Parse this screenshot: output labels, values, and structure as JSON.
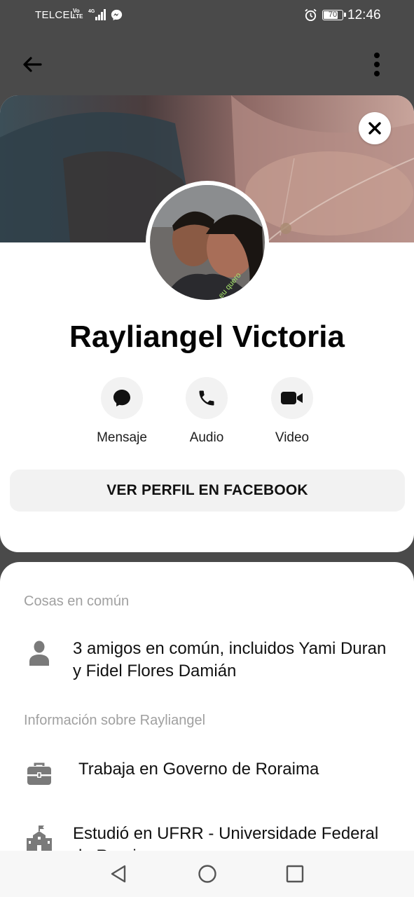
{
  "status_bar": {
    "carrier": "TELCEL",
    "network_top": "Vo",
    "network_bottom": "LTE",
    "network_gen": "4G",
    "battery": "70",
    "time": "12:46"
  },
  "app_bar": {
    "back_icon": "arrow-left-icon",
    "more_icon": "more-vertical-icon"
  },
  "profile": {
    "name": "Rayliangel Victoria",
    "avatar_overlay_text": "eu quero",
    "actions": [
      {
        "label": "Mensaje",
        "icon": "chat-bubble-icon"
      },
      {
        "label": "Audio",
        "icon": "phone-icon"
      },
      {
        "label": "Video",
        "icon": "video-camera-icon"
      }
    ],
    "fb_button": "VER PERFIL EN FACEBOOK"
  },
  "info": {
    "common_header": "Cosas en común",
    "common_friends": "3 amigos en común, incluidos Yami Duran y Fidel Flores Damián",
    "about_header": "Información sobre Rayliangel",
    "work": "Trabaja en Governo de Roraima",
    "education": "Estudió en UFRR - Universidade Federal de Roraima"
  },
  "colors": {
    "background_dim": "#4a4a4a",
    "card": "#ffffff",
    "button_bg": "#f2f2f2",
    "muted_text": "#a0a0a0",
    "icon_gray": "#7a7a7a"
  }
}
